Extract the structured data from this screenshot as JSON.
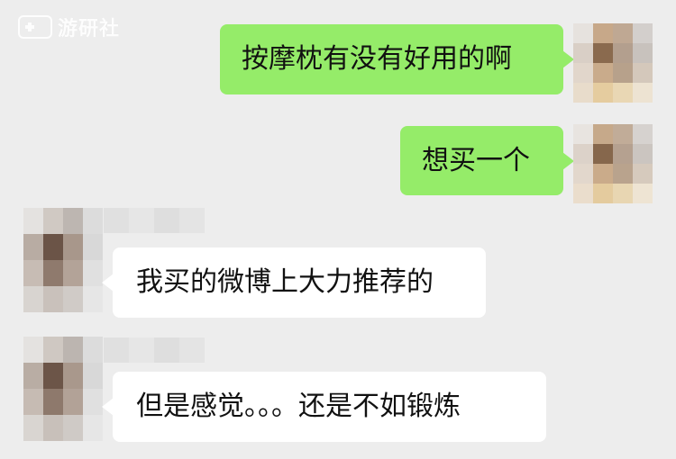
{
  "watermark": {
    "text": "游研社",
    "icon": "gamepad-icon"
  },
  "messages": [
    {
      "sender": "me",
      "text": "按摩枕有没有好用的啊"
    },
    {
      "sender": "me",
      "text": "想买一个"
    },
    {
      "sender": "other",
      "text": "我买的微博上大力推荐的"
    },
    {
      "sender": "other",
      "text": "但是感觉。。。还是不如锻炼"
    }
  ],
  "colors": {
    "background": "#ededed",
    "my_bubble": "#95ec69",
    "other_bubble": "#ffffff",
    "text": "#111111"
  }
}
